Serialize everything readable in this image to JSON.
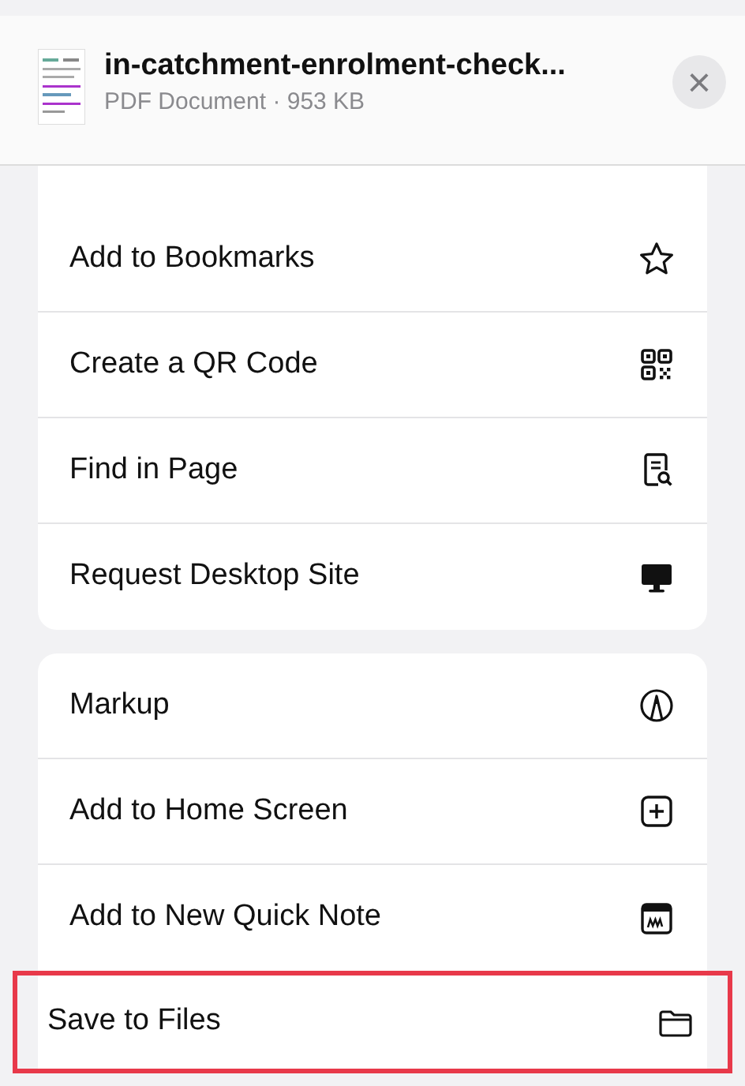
{
  "header": {
    "title": "in-catchment-enrolment-check...",
    "subtitle": "PDF Document · 953 KB",
    "close": "×"
  },
  "groups": [
    {
      "items": [
        {
          "label": "Add to Bookmarks",
          "kind": "star",
          "highlighted": false
        },
        {
          "label": "Create a QR Code",
          "kind": "qr",
          "highlighted": false
        },
        {
          "label": "Find in Page",
          "kind": "find",
          "highlighted": false
        },
        {
          "label": "Request Desktop Site",
          "kind": "desktop",
          "highlighted": false
        }
      ]
    },
    {
      "items": [
        {
          "label": "Markup",
          "kind": "markup",
          "highlighted": false
        },
        {
          "label": "Add to Home Screen",
          "kind": "plus",
          "highlighted": false
        },
        {
          "label": "Add to New Quick Note",
          "kind": "note",
          "highlighted": false
        },
        {
          "label": "Save to Files",
          "kind": "folder",
          "highlighted": true
        }
      ]
    }
  ]
}
